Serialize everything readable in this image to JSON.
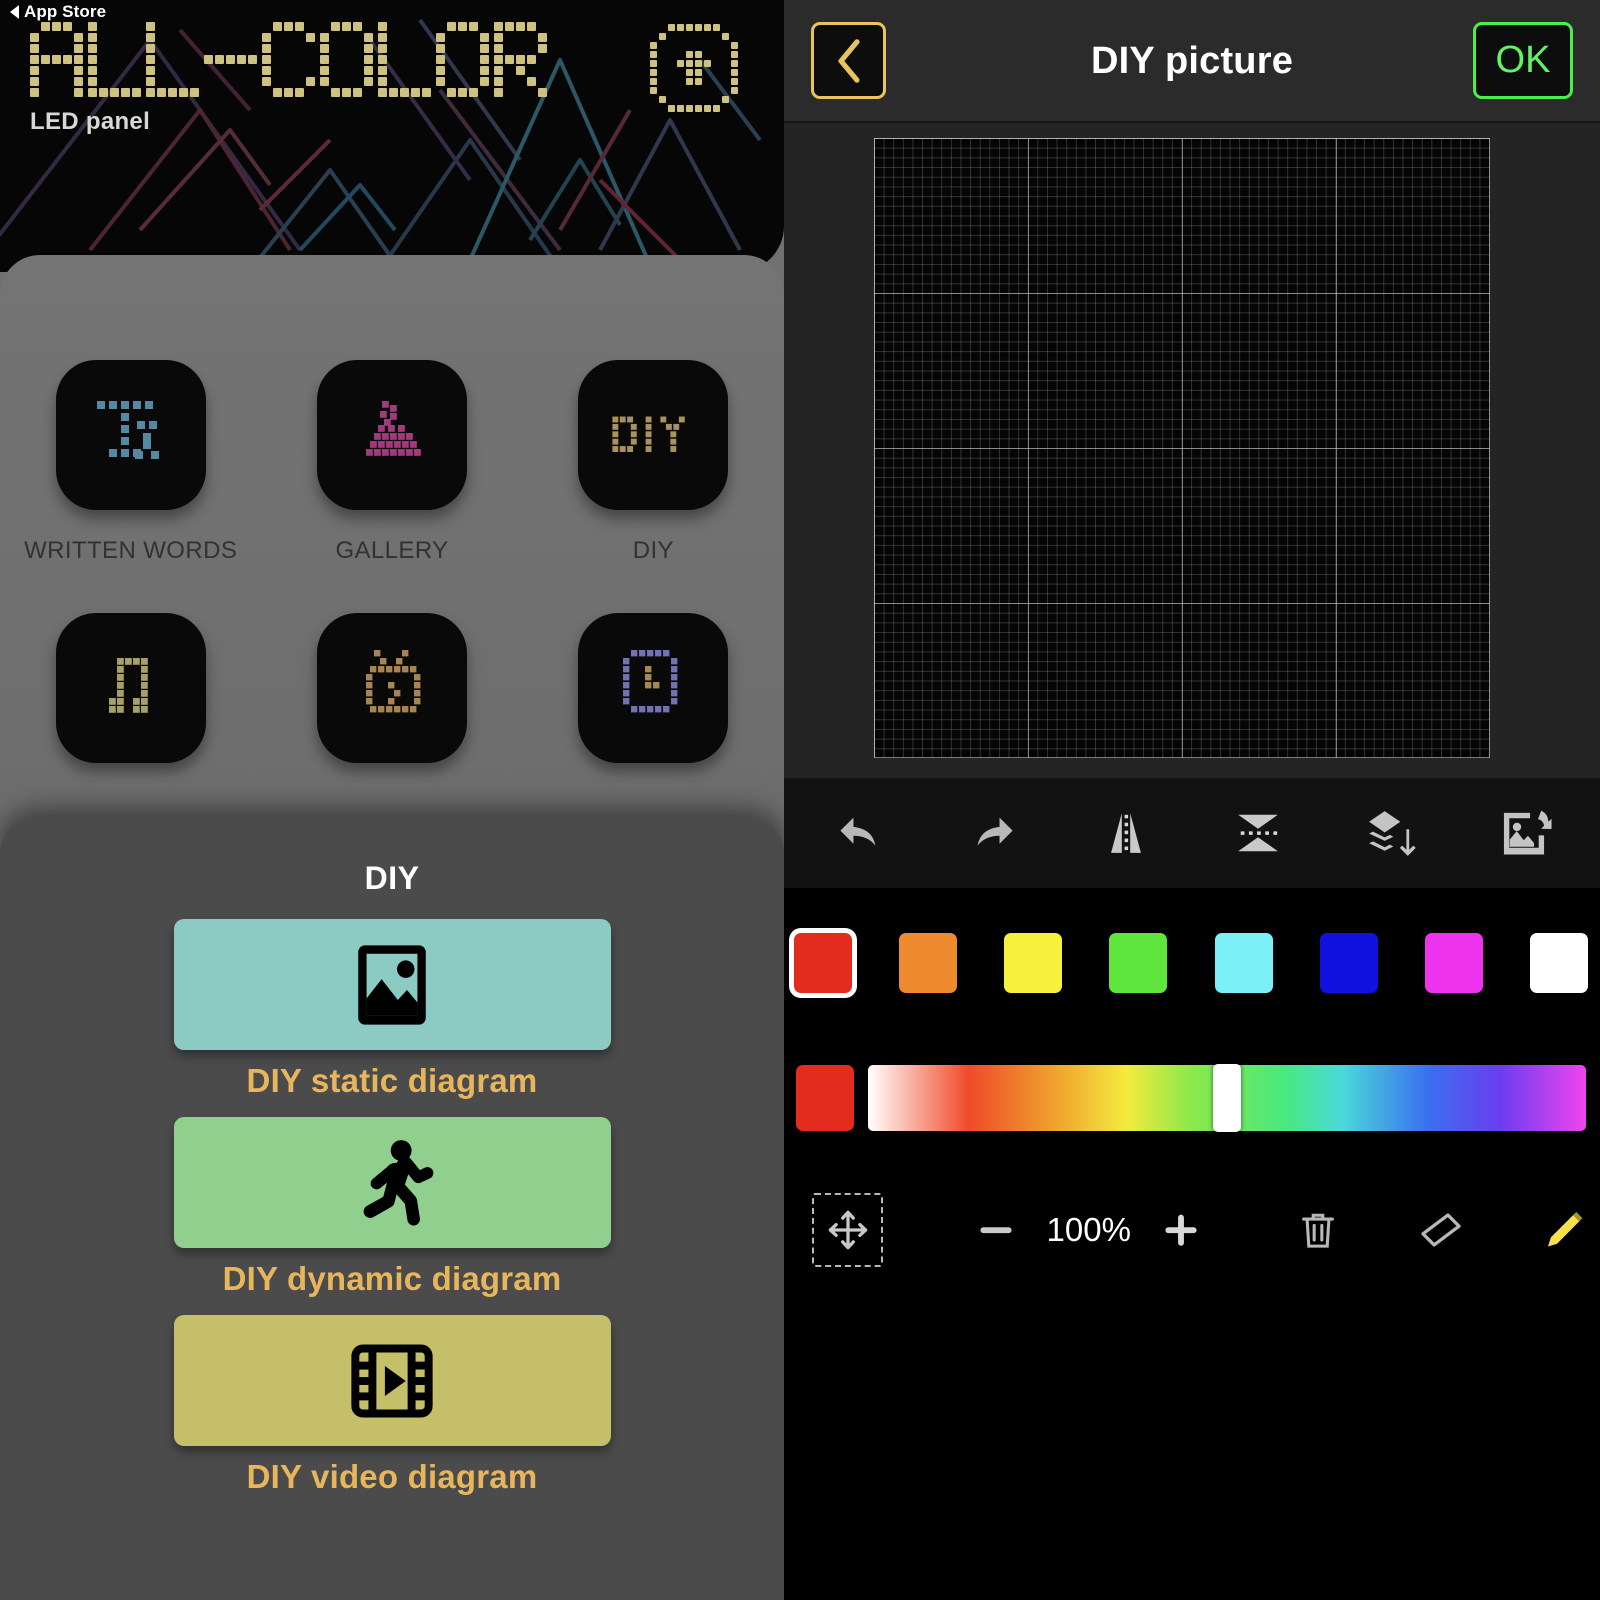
{
  "left": {
    "statusbar": {
      "back_label": "App Store",
      "icon": "back-triangle-icon"
    },
    "hero": {
      "title": "ALL-COLOR",
      "subtitle": "LED panel",
      "add_icon": "add-device-icon"
    },
    "tiles": [
      {
        "label": "WRITTEN WORDS",
        "icon": "text-format-icon",
        "color": "#6aa7c8"
      },
      {
        "label": "GALLERY",
        "icon": "gallery-person-icon",
        "color": "#c9479a"
      },
      {
        "label": "DIY",
        "icon": "diy-text-icon",
        "color": "#cfb372"
      },
      {
        "label": "",
        "icon": "music-note-icon",
        "color": "#cdc382"
      },
      {
        "label": "",
        "icon": "tv-icon",
        "color": "#cfa06a"
      },
      {
        "label": "",
        "icon": "clock-icon",
        "color": "#8b8bd8"
      }
    ],
    "sheet": {
      "title": "DIY",
      "options": [
        {
          "label": "DIY static diagram",
          "icon": "image-icon",
          "color": "#8ccbc4"
        },
        {
          "label": "DIY dynamic diagram",
          "icon": "running-icon",
          "color": "#91cf8e"
        },
        {
          "label": "DIY video diagram",
          "icon": "film-play-icon",
          "color": "#c5bf6a"
        }
      ],
      "label_color": "#e7b65c"
    }
  },
  "right": {
    "topbar": {
      "back_icon": "chevron-left-icon",
      "back_border_color": "#e7c55c",
      "title": "DIY picture",
      "ok_label": "OK",
      "ok_color": "#63f263"
    },
    "canvas": {
      "name": "pixel-grid-canvas",
      "columns": 64,
      "rows": 64,
      "major_every": 16,
      "background": "#050505"
    },
    "toolbar": [
      {
        "name": "undo-button",
        "icon": "undo-arrow-icon"
      },
      {
        "name": "redo-button",
        "icon": "redo-arrow-icon"
      },
      {
        "name": "flip-horizontal-button",
        "icon": "flip-horizontal-icon"
      },
      {
        "name": "flip-vertical-button",
        "icon": "flip-vertical-icon"
      },
      {
        "name": "layer-order-button",
        "icon": "layers-reorder-icon"
      },
      {
        "name": "import-image-button",
        "icon": "image-import-icon"
      }
    ],
    "palette": {
      "swatches": [
        {
          "name": "swatch-red",
          "hex": "#E32B1E",
          "selected": true
        },
        {
          "name": "swatch-orange",
          "hex": "#EE8B2E",
          "selected": false
        },
        {
          "name": "swatch-yellow",
          "hex": "#F7F13E",
          "selected": false
        },
        {
          "name": "swatch-green",
          "hex": "#5EE63C",
          "selected": false
        },
        {
          "name": "swatch-cyan",
          "hex": "#7BF0F7",
          "selected": false
        },
        {
          "name": "swatch-blue",
          "hex": "#1111E0",
          "selected": false
        },
        {
          "name": "swatch-magenta",
          "hex": "#EE33EE",
          "selected": false
        },
        {
          "name": "swatch-white",
          "hex": "#FFFFFF",
          "selected": false
        }
      ],
      "current_color": "#E32B1E",
      "hue_thumb_percent": 50
    },
    "bottom": {
      "move_icon": "move-arrows-icon",
      "minus_label": "minus-icon",
      "zoom_value": "100%",
      "plus_label": "plus-icon",
      "trash_icon": "trash-icon",
      "eraser_icon": "eraser-icon",
      "pencil_icon": "pencil-icon",
      "pencil_color": "#f5e24a"
    }
  }
}
